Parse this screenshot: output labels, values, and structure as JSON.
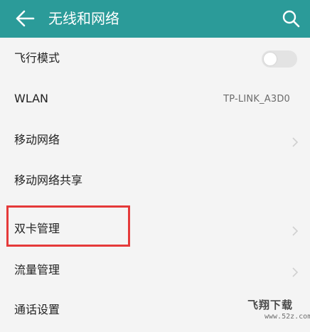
{
  "header": {
    "title": "无线和网络",
    "back_icon": "back-arrow-icon",
    "search_icon": "search-icon",
    "color": "#2b9b99"
  },
  "settings": {
    "airplane_mode": {
      "label": "飞行模式",
      "toggle_on": false
    },
    "wlan": {
      "label": "WLAN",
      "value": "TP-LINK_A3D0"
    },
    "mobile_network": {
      "label": "移动网络"
    },
    "hotspot": {
      "label": "移动网络共享"
    },
    "dual_sim": {
      "label": "双卡管理",
      "highlighted": true,
      "highlight_color": "#e53a3a"
    },
    "data_usage": {
      "label": "流量管理"
    },
    "call_settings": {
      "label": "通话设置"
    }
  },
  "watermark": {
    "text": "飞翔下载",
    "url": "www.52z.com"
  }
}
